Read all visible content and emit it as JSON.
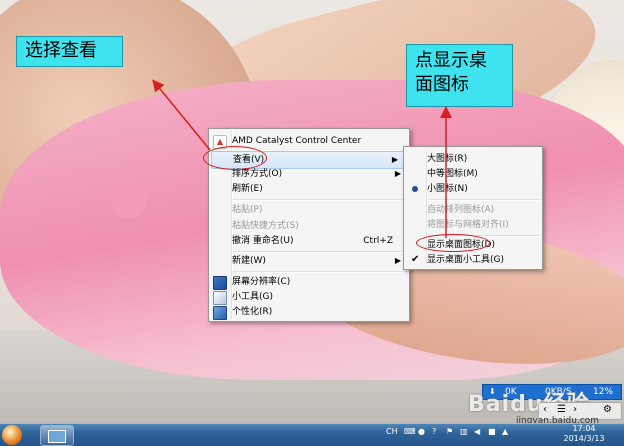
{
  "callouts": {
    "left": "选择查看",
    "right": "点显示桌\n面图标"
  },
  "context_menu": {
    "items": [
      {
        "label": "AMD Catalyst Control Center",
        "icon": "amd-icon"
      },
      {
        "label": "查看(V)",
        "submenu": true,
        "highlighted": true
      },
      {
        "label": "排序方式(O)",
        "submenu": true
      },
      {
        "label": "刷新(E)"
      },
      {
        "label": "粘贴(P)",
        "disabled": true
      },
      {
        "label": "粘贴快捷方式(S)",
        "disabled": true
      },
      {
        "label": "撤消 重命名(U)",
        "shortcut": "Ctrl+Z"
      },
      {
        "label": "新建(W)",
        "submenu": true
      },
      {
        "label": "屏幕分辨率(C)",
        "icon": "screen-resolution-icon"
      },
      {
        "label": "小工具(G)",
        "icon": "gadgets-icon"
      },
      {
        "label": "个性化(R)",
        "icon": "personalize-icon"
      }
    ]
  },
  "view_submenu": {
    "items": [
      {
        "label": "大图标(R)"
      },
      {
        "label": "中等图标(M)"
      },
      {
        "label": "小图标(N)",
        "selected": true
      },
      {
        "label": "自动排列图标(A)",
        "disabled": true
      },
      {
        "label": "将图标与网格对齐(I)",
        "disabled": true
      },
      {
        "label": "显示桌面图标(D)"
      },
      {
        "label": "显示桌面小工具(G)",
        "checked": true
      }
    ]
  },
  "network_widget": {
    "up": "0K",
    "rate1": "0K",
    "rate2": "0KB/S",
    "percent": "12%"
  },
  "tray": {
    "ime": "CH",
    "clock_time": "17:04",
    "clock_date": "2014/3/13"
  },
  "watermark": {
    "text": "Baidu经验",
    "url": "jingyan.baidu.com"
  },
  "colors": {
    "callout_bg": "#3fe3f0",
    "annotation_red": "#d81e1e",
    "taskbar": "#2f6398"
  }
}
